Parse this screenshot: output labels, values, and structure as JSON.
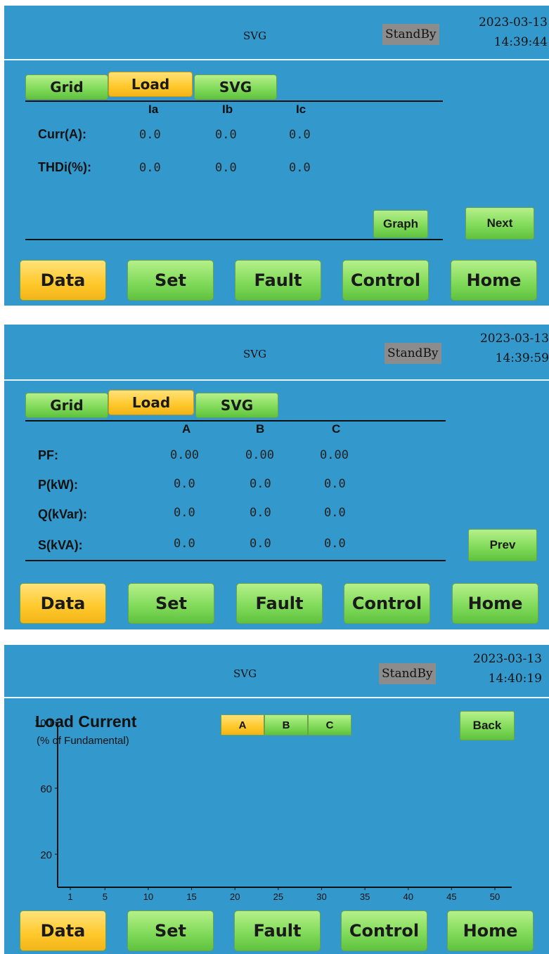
{
  "screen1": {
    "header": {
      "title": "SVG",
      "status": "StandBy",
      "date": "2023-03-13",
      "time": "14:39:44"
    },
    "tabs": [
      "Grid",
      "Load",
      "SVG"
    ],
    "active_tab": "Load",
    "columns": [
      "Ia",
      "Ib",
      "Ic"
    ],
    "rows": [
      {
        "label": "Curr(A):",
        "values": [
          "0.0",
          "0.0",
          "0.0"
        ]
      },
      {
        "label": "THDi(%):",
        "values": [
          "0.0",
          "0.0",
          "0.0"
        ]
      }
    ],
    "graph_label": "Graph",
    "next_label": "Next"
  },
  "screen2": {
    "header": {
      "title": "SVG",
      "status": "StandBy",
      "date": "2023-03-13",
      "time": "14:39:59"
    },
    "tabs": [
      "Grid",
      "Load",
      "SVG"
    ],
    "active_tab": "Load",
    "columns": [
      "A",
      "B",
      "C"
    ],
    "rows": [
      {
        "label": "PF:",
        "values": [
          "0.00",
          "0.00",
          "0.00"
        ]
      },
      {
        "label": "P(kW):",
        "values": [
          "0.0",
          "0.0",
          "0.0"
        ]
      },
      {
        "label": "Q(kVar):",
        "values": [
          "0.0",
          "0.0",
          "0.0"
        ]
      },
      {
        "label": "S(kVA):",
        "values": [
          "0.0",
          "0.0",
          "0.0"
        ]
      }
    ],
    "prev_label": "Prev"
  },
  "screen3": {
    "header": {
      "title": "SVG",
      "status": "StandBy",
      "date": "2023-03-13",
      "time": "14:40:19"
    },
    "chart_title": "Load Current",
    "chart_subtitle": "(% of Fundamental)",
    "phases": [
      "A",
      "B",
      "C"
    ],
    "active_phase": "A",
    "back_label": "Back"
  },
  "nav": {
    "data": "Data",
    "set": "Set",
    "fault": "Fault",
    "control": "Control",
    "home": "Home"
  },
  "colors": {
    "screen_bg": "#3399cc",
    "button_green": "#7ed957",
    "button_active": "#ffc82a",
    "status_bg": "#8c8c8c"
  },
  "chart_data": {
    "type": "bar",
    "title": "Load Current",
    "subtitle": "(% of Fundamental)",
    "x_tick_labels": [
      "1",
      "5",
      "10",
      "15",
      "20",
      "25",
      "30",
      "35",
      "40",
      "45",
      "50"
    ],
    "y_tick_labels": [
      "100",
      "60",
      "20"
    ],
    "xlim": [
      1,
      50
    ],
    "ylim": [
      0,
      100
    ],
    "series": [
      {
        "values": []
      }
    ]
  }
}
